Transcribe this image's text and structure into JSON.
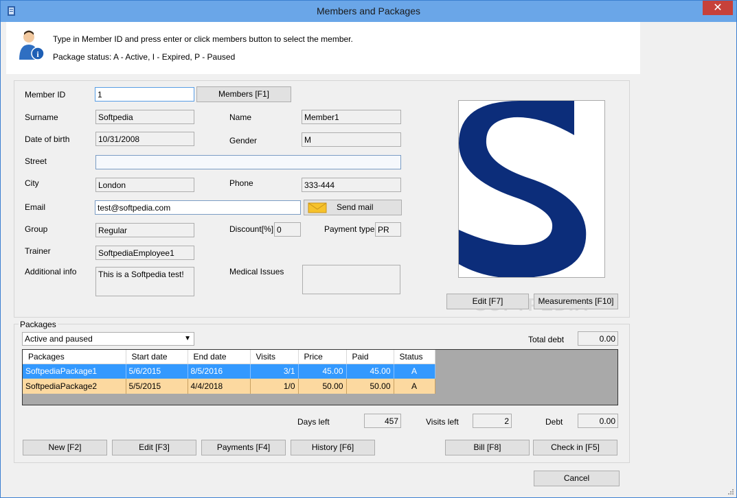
{
  "window": {
    "title": "Members and Packages",
    "close_glyph": "✕"
  },
  "info": {
    "line1": "Type in Member ID and press enter or click members button to select the member.",
    "line2": "Package status: A - Active, I - Expired, P - Paused"
  },
  "member": {
    "id_label": "Member ID",
    "id_value": "1",
    "members_button": "Members  [F1]",
    "surname_label": "Surname",
    "surname_value": "Softpedia",
    "name_label": "Name",
    "name_value": "Member1",
    "dob_label": "Date of birth",
    "dob_value": "10/31/2008",
    "gender_label": "Gender",
    "gender_value": "M",
    "street_label": "Street",
    "street_value": "",
    "city_label": "City",
    "city_value": "London",
    "phone_label": "Phone",
    "phone_value": "333-444",
    "email_label": "Email",
    "email_value": "test@softpedia.com",
    "send_mail_button": "Send mail",
    "group_label": "Group",
    "group_value": "Regular",
    "discount_label": "Discount[%]",
    "discount_value": "0",
    "payment_type_label": "Payment  type",
    "payment_type_value": "PR",
    "trainer_label": "Trainer",
    "trainer_value": "SoftpediaEmployee1",
    "additional_label": "Additional info",
    "additional_value": "This is a Softpedia test!",
    "medical_label": "Medical Issues",
    "medical_value": ""
  },
  "photo": {
    "edit_button": "Edit  [F7]",
    "measurements_button": "Measurements  [F10]",
    "watermark": "SOFTPEDIA"
  },
  "packages": {
    "group_label": "Packages",
    "filter_value": "Active and paused",
    "total_debt_label": "Total debt",
    "total_debt_value": "0.00",
    "columns": [
      "Packages",
      "Start date",
      "End date",
      "Visits",
      "Price",
      "Paid",
      "Status"
    ],
    "rows": [
      {
        "name": "SoftpediaPackage1",
        "start": "5/6/2015",
        "end": "8/5/2016",
        "visits": "3/1",
        "price": "45.00",
        "paid": "45.00",
        "status": "A"
      },
      {
        "name": "SoftpediaPackage2",
        "start": "5/5/2015",
        "end": "4/4/2018",
        "visits": "1/0",
        "price": "50.00",
        "paid": "50.00",
        "status": "A"
      }
    ],
    "days_left_label": "Days left",
    "days_left_value": "457",
    "visits_left_label": "Visits left",
    "visits_left_value": "2",
    "debt_label": "Debt",
    "debt_value": "0.00"
  },
  "buttons": {
    "new": "New  [F2]",
    "edit": "Edit   [F3]",
    "payments": "Payments  [F4]",
    "history": "History  [F6]",
    "bill": "Bill  [F8]",
    "checkin": "Check in  [F5]",
    "cancel": "Cancel"
  },
  "colors": {
    "accent": "#3399ff",
    "alt_row": "#fcd9a0",
    "titlebar": "#6aa6e8",
    "logo": "#0c2d7a"
  }
}
